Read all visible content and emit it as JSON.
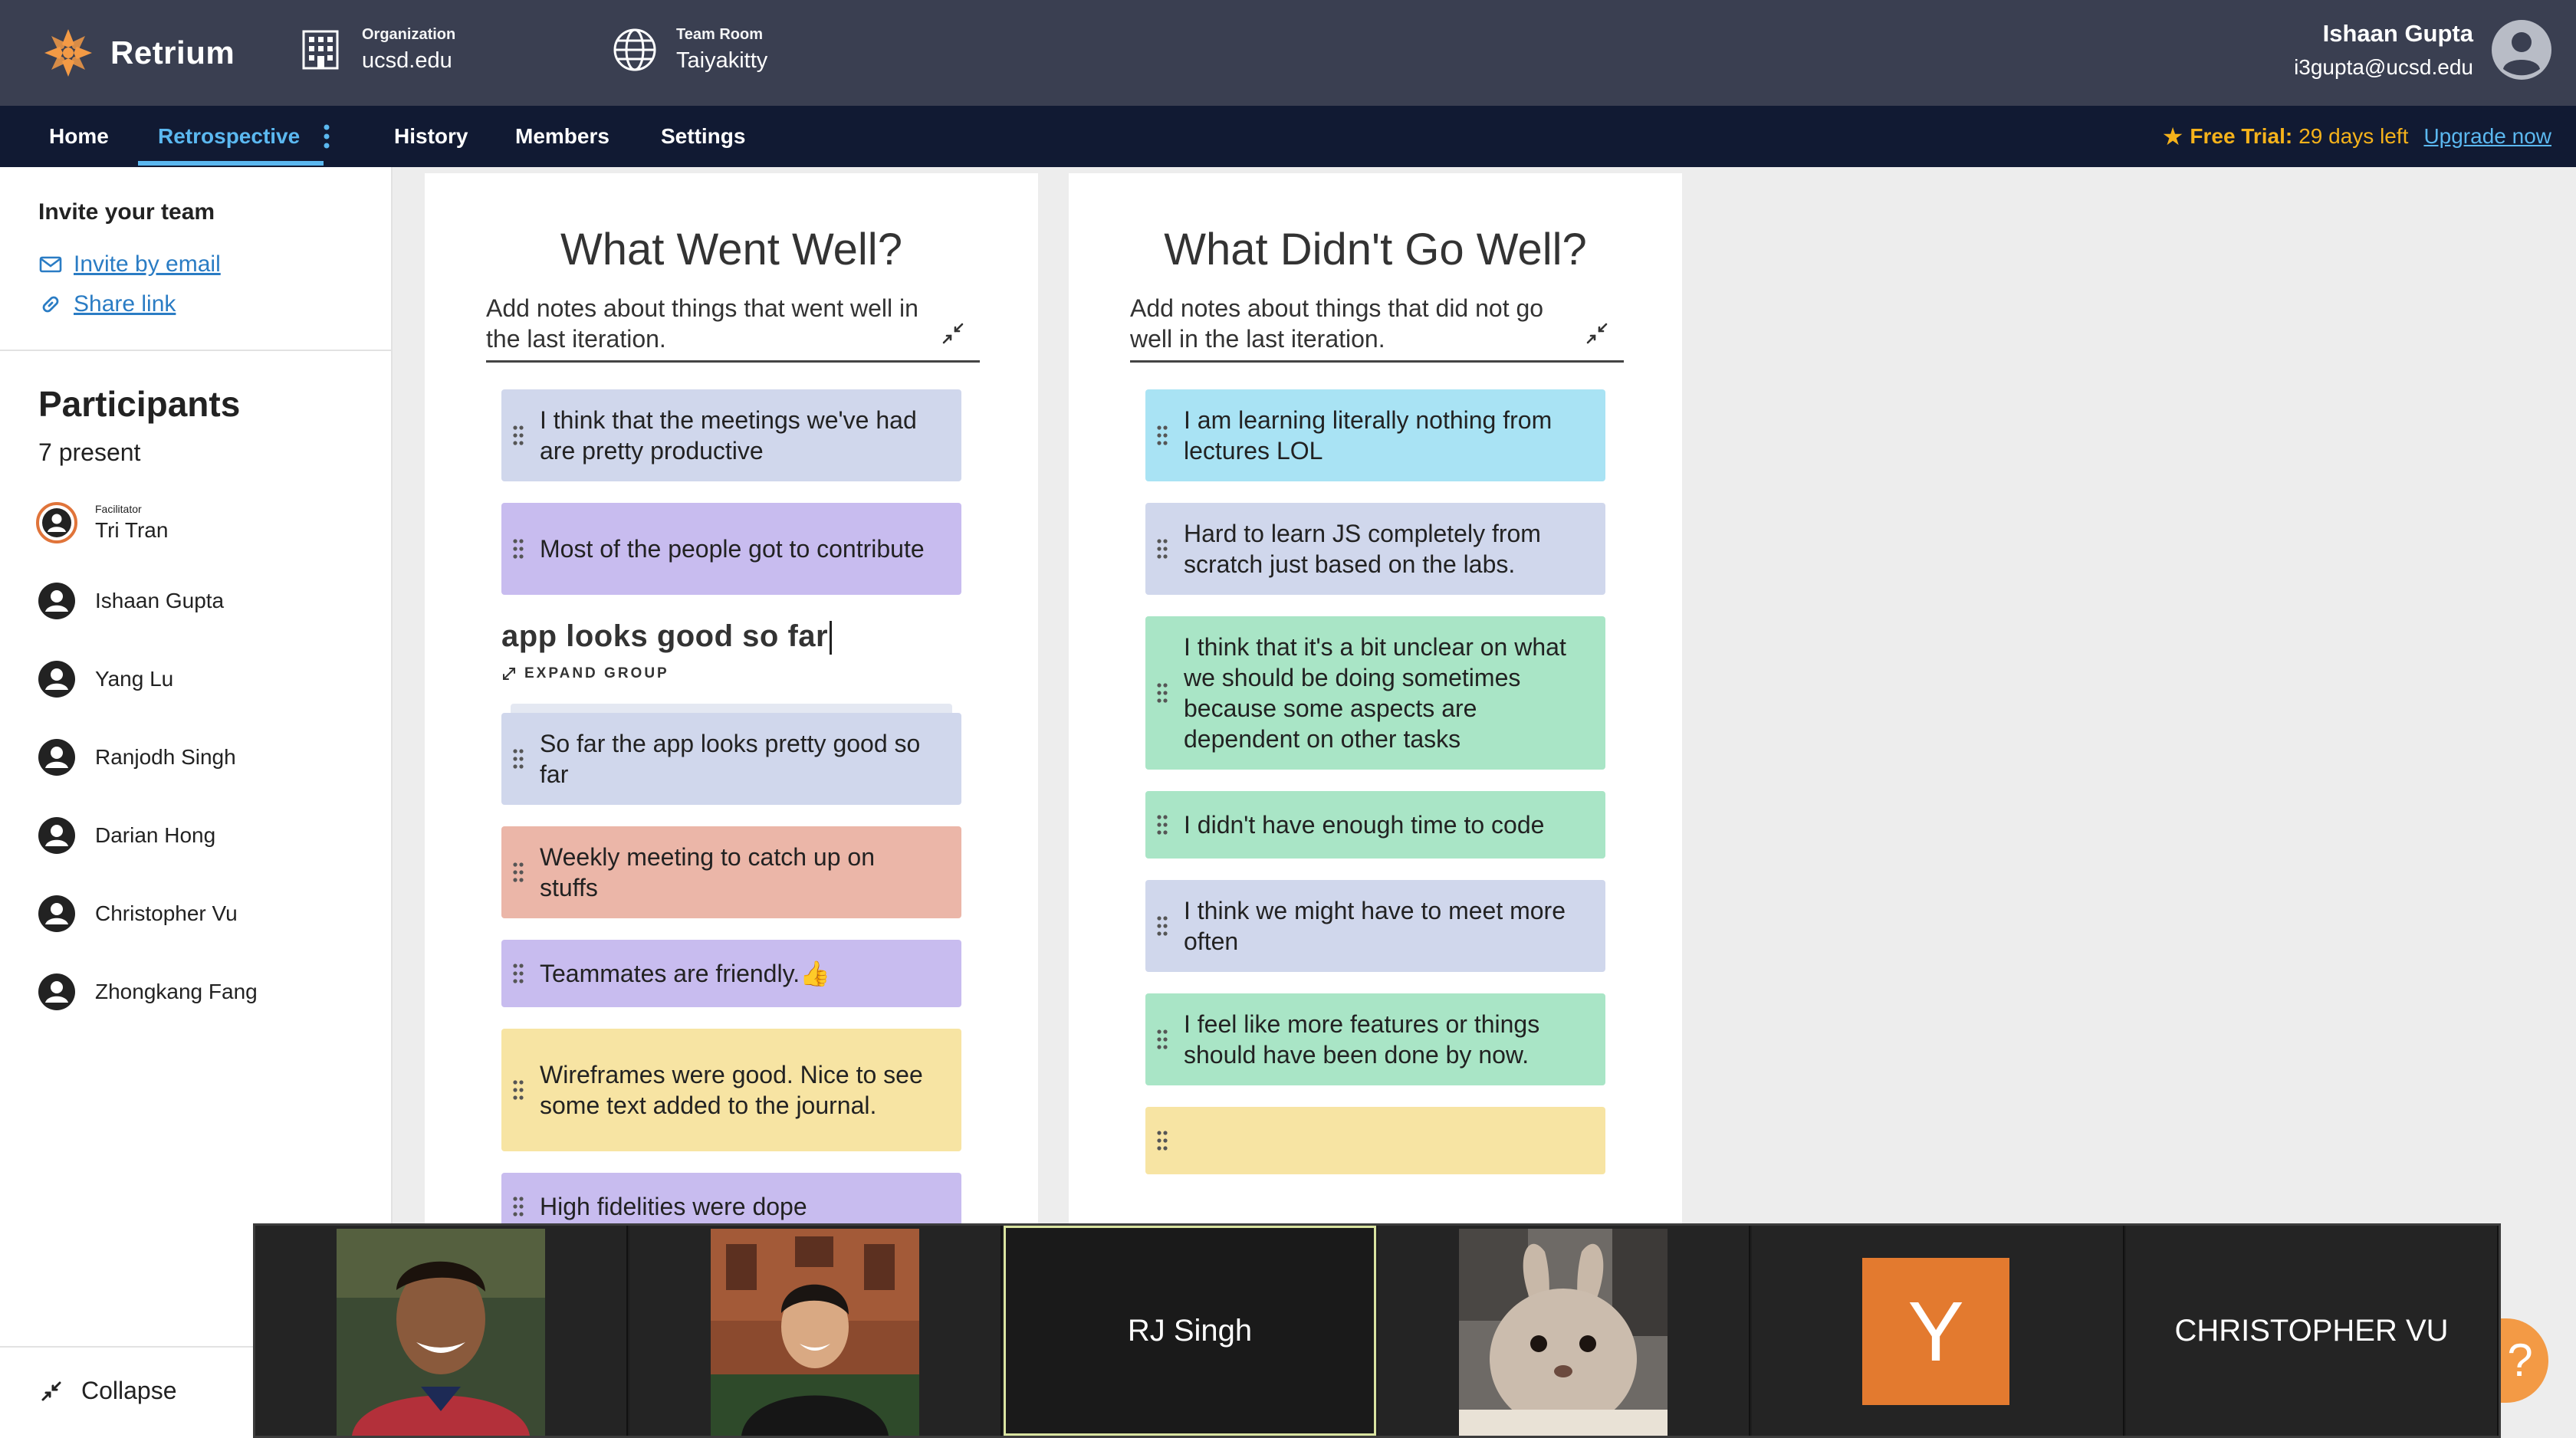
{
  "header": {
    "brand": "Retrium",
    "org_label": "Organization",
    "org_value": "ucsd.edu",
    "room_label": "Team Room",
    "room_value": "Taiyakitty",
    "user_name": "Ishaan Gupta",
    "user_email": "i3gupta@ucsd.edu"
  },
  "nav": {
    "items": [
      "Home",
      "Retrospective",
      "History",
      "Members",
      "Settings"
    ],
    "active": "Retrospective",
    "trial_label": "Free Trial:",
    "trial_days": "29 days left",
    "upgrade": "Upgrade now"
  },
  "sidebar": {
    "invite_title": "Invite your team",
    "invite_email": "Invite by email",
    "share_link": "Share link",
    "participants_title": "Participants",
    "present_count": "7 present",
    "facilitator_role": "Facilitator",
    "participants": [
      "Tri Tran",
      "Ishaan Gupta",
      "Yang Lu",
      "Ranjodh Singh",
      "Darian Hong",
      "Christopher Vu",
      "Zhongkang Fang"
    ],
    "collapse": "Collapse"
  },
  "columns": [
    {
      "title": "What Went Well?",
      "description": "Add notes about things that went well in the last iteration.",
      "cards": [
        "I think that the meetings we've had are pretty productive",
        "Most of the people got to contribute"
      ],
      "group_title": "app looks good so far",
      "expand_label": "EXPAND GROUP",
      "cards_after": [
        "So far the app looks pretty good so far",
        "Weekly meeting to catch up on stuffs",
        "Teammates are friendly.👍",
        "Wireframes were good. Nice to see some text added to the journal.",
        "High fidelities were dope"
      ]
    },
    {
      "title": "What Didn't Go Well?",
      "description": "Add notes about things that did not go well in the last iteration.",
      "cards": [
        "I am learning literally nothing from lectures LOL",
        "Hard to learn JS completely from scratch just based on the labs.",
        "I think that it's a bit unclear on what we should be doing sometimes because some aspects are dependent on other tasks",
        "I didn't have enough time to code",
        "I think we might have to meet more often",
        "I feel like more features or things should have been done by now.",
        ""
      ]
    }
  ],
  "video": {
    "tiles": [
      "",
      "",
      "RJ Singh",
      "",
      "Y",
      "CHRISTOPHER VU"
    ]
  },
  "help": "?",
  "colors": {
    "header_bg": "#3a3f51",
    "nav_bg": "#111a33",
    "accent": "#5bb8f0",
    "trial": "#f5b21b",
    "card_blue": "#d0d7ec",
    "card_purple": "#c8bcef",
    "card_salmon": "#ebb6a8",
    "card_yellow": "#f7e4a3",
    "card_cyan": "#a9e3f4",
    "card_green": "#a9e5c6"
  }
}
